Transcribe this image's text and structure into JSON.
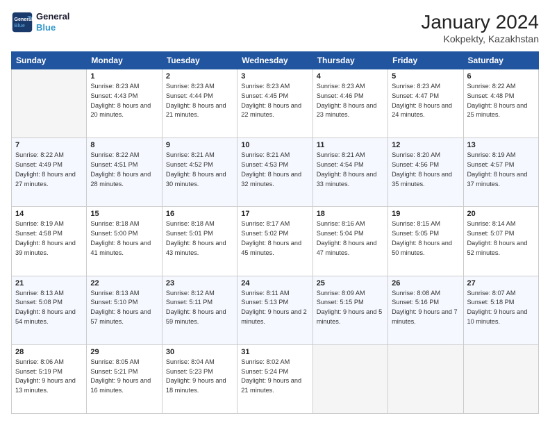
{
  "header": {
    "logo_line1": "General",
    "logo_line2": "Blue",
    "title": "January 2024",
    "subtitle": "Kokpekty, Kazakhstan"
  },
  "weekdays": [
    "Sunday",
    "Monday",
    "Tuesday",
    "Wednesday",
    "Thursday",
    "Friday",
    "Saturday"
  ],
  "weeks": [
    [
      {
        "day": "",
        "sunrise": "",
        "sunset": "",
        "daylight": ""
      },
      {
        "day": "1",
        "sunrise": "Sunrise: 8:23 AM",
        "sunset": "Sunset: 4:43 PM",
        "daylight": "Daylight: 8 hours and 20 minutes."
      },
      {
        "day": "2",
        "sunrise": "Sunrise: 8:23 AM",
        "sunset": "Sunset: 4:44 PM",
        "daylight": "Daylight: 8 hours and 21 minutes."
      },
      {
        "day": "3",
        "sunrise": "Sunrise: 8:23 AM",
        "sunset": "Sunset: 4:45 PM",
        "daylight": "Daylight: 8 hours and 22 minutes."
      },
      {
        "day": "4",
        "sunrise": "Sunrise: 8:23 AM",
        "sunset": "Sunset: 4:46 PM",
        "daylight": "Daylight: 8 hours and 23 minutes."
      },
      {
        "day": "5",
        "sunrise": "Sunrise: 8:23 AM",
        "sunset": "Sunset: 4:47 PM",
        "daylight": "Daylight: 8 hours and 24 minutes."
      },
      {
        "day": "6",
        "sunrise": "Sunrise: 8:22 AM",
        "sunset": "Sunset: 4:48 PM",
        "daylight": "Daylight: 8 hours and 25 minutes."
      }
    ],
    [
      {
        "day": "7",
        "sunrise": "Sunrise: 8:22 AM",
        "sunset": "Sunset: 4:49 PM",
        "daylight": "Daylight: 8 hours and 27 minutes."
      },
      {
        "day": "8",
        "sunrise": "Sunrise: 8:22 AM",
        "sunset": "Sunset: 4:51 PM",
        "daylight": "Daylight: 8 hours and 28 minutes."
      },
      {
        "day": "9",
        "sunrise": "Sunrise: 8:21 AM",
        "sunset": "Sunset: 4:52 PM",
        "daylight": "Daylight: 8 hours and 30 minutes."
      },
      {
        "day": "10",
        "sunrise": "Sunrise: 8:21 AM",
        "sunset": "Sunset: 4:53 PM",
        "daylight": "Daylight: 8 hours and 32 minutes."
      },
      {
        "day": "11",
        "sunrise": "Sunrise: 8:21 AM",
        "sunset": "Sunset: 4:54 PM",
        "daylight": "Daylight: 8 hours and 33 minutes."
      },
      {
        "day": "12",
        "sunrise": "Sunrise: 8:20 AM",
        "sunset": "Sunset: 4:56 PM",
        "daylight": "Daylight: 8 hours and 35 minutes."
      },
      {
        "day": "13",
        "sunrise": "Sunrise: 8:19 AM",
        "sunset": "Sunset: 4:57 PM",
        "daylight": "Daylight: 8 hours and 37 minutes."
      }
    ],
    [
      {
        "day": "14",
        "sunrise": "Sunrise: 8:19 AM",
        "sunset": "Sunset: 4:58 PM",
        "daylight": "Daylight: 8 hours and 39 minutes."
      },
      {
        "day": "15",
        "sunrise": "Sunrise: 8:18 AM",
        "sunset": "Sunset: 5:00 PM",
        "daylight": "Daylight: 8 hours and 41 minutes."
      },
      {
        "day": "16",
        "sunrise": "Sunrise: 8:18 AM",
        "sunset": "Sunset: 5:01 PM",
        "daylight": "Daylight: 8 hours and 43 minutes."
      },
      {
        "day": "17",
        "sunrise": "Sunrise: 8:17 AM",
        "sunset": "Sunset: 5:02 PM",
        "daylight": "Daylight: 8 hours and 45 minutes."
      },
      {
        "day": "18",
        "sunrise": "Sunrise: 8:16 AM",
        "sunset": "Sunset: 5:04 PM",
        "daylight": "Daylight: 8 hours and 47 minutes."
      },
      {
        "day": "19",
        "sunrise": "Sunrise: 8:15 AM",
        "sunset": "Sunset: 5:05 PM",
        "daylight": "Daylight: 8 hours and 50 minutes."
      },
      {
        "day": "20",
        "sunrise": "Sunrise: 8:14 AM",
        "sunset": "Sunset: 5:07 PM",
        "daylight": "Daylight: 8 hours and 52 minutes."
      }
    ],
    [
      {
        "day": "21",
        "sunrise": "Sunrise: 8:13 AM",
        "sunset": "Sunset: 5:08 PM",
        "daylight": "Daylight: 8 hours and 54 minutes."
      },
      {
        "day": "22",
        "sunrise": "Sunrise: 8:13 AM",
        "sunset": "Sunset: 5:10 PM",
        "daylight": "Daylight: 8 hours and 57 minutes."
      },
      {
        "day": "23",
        "sunrise": "Sunrise: 8:12 AM",
        "sunset": "Sunset: 5:11 PM",
        "daylight": "Daylight: 8 hours and 59 minutes."
      },
      {
        "day": "24",
        "sunrise": "Sunrise: 8:11 AM",
        "sunset": "Sunset: 5:13 PM",
        "daylight": "Daylight: 9 hours and 2 minutes."
      },
      {
        "day": "25",
        "sunrise": "Sunrise: 8:09 AM",
        "sunset": "Sunset: 5:15 PM",
        "daylight": "Daylight: 9 hours and 5 minutes."
      },
      {
        "day": "26",
        "sunrise": "Sunrise: 8:08 AM",
        "sunset": "Sunset: 5:16 PM",
        "daylight": "Daylight: 9 hours and 7 minutes."
      },
      {
        "day": "27",
        "sunrise": "Sunrise: 8:07 AM",
        "sunset": "Sunset: 5:18 PM",
        "daylight": "Daylight: 9 hours and 10 minutes."
      }
    ],
    [
      {
        "day": "28",
        "sunrise": "Sunrise: 8:06 AM",
        "sunset": "Sunset: 5:19 PM",
        "daylight": "Daylight: 9 hours and 13 minutes."
      },
      {
        "day": "29",
        "sunrise": "Sunrise: 8:05 AM",
        "sunset": "Sunset: 5:21 PM",
        "daylight": "Daylight: 9 hours and 16 minutes."
      },
      {
        "day": "30",
        "sunrise": "Sunrise: 8:04 AM",
        "sunset": "Sunset: 5:23 PM",
        "daylight": "Daylight: 9 hours and 18 minutes."
      },
      {
        "day": "31",
        "sunrise": "Sunrise: 8:02 AM",
        "sunset": "Sunset: 5:24 PM",
        "daylight": "Daylight: 9 hours and 21 minutes."
      },
      {
        "day": "",
        "sunrise": "",
        "sunset": "",
        "daylight": ""
      },
      {
        "day": "",
        "sunrise": "",
        "sunset": "",
        "daylight": ""
      },
      {
        "day": "",
        "sunrise": "",
        "sunset": "",
        "daylight": ""
      }
    ]
  ]
}
